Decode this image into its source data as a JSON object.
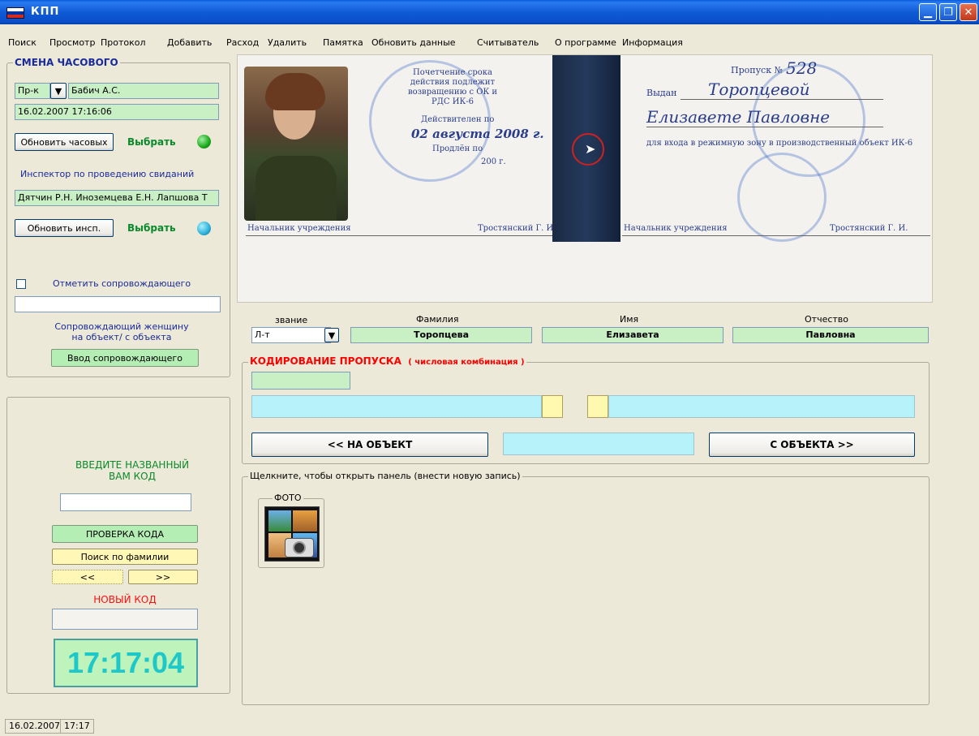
{
  "window": {
    "title": "КПП",
    "colors": {
      "titlebar": "#0a5bd8",
      "green_field": "#c8f0c4",
      "cyan_field": "#b7f2fa",
      "header_red": "#ff0000",
      "clock_text": "#1ec8c8"
    }
  },
  "menu": [
    "Поиск",
    "Просмотр",
    "Протокол",
    "Добавить",
    "Расход",
    "Удалить",
    "Памятка",
    "Обновить данные",
    "Считыватель",
    "О программе",
    "Информация"
  ],
  "guard": {
    "title": "СМЕНА ЧАСОВОГО",
    "rank": "Пр-к",
    "name": "Бабич А.С.",
    "datetime": "16.02.2007 17:16:06",
    "refresh_guards": "Обновить часовых",
    "select1": "Выбрать",
    "inspector_label": "Инспектор по проведению свиданий",
    "inspectors": "Дятчин Р.Н. Иноземцева Е.Н. Лапшова Т",
    "refresh_insp": "Обновить инсп.",
    "select2": "Выбрать",
    "escort_checkbox": "Отметить сопровождающего",
    "escort_value": "",
    "escort_note": "Сопровождающий женщину\nна объект/ с объекта",
    "escort_button": "Ввод сопровождающего"
  },
  "code_panel": {
    "prompt": "ВВЕДИТЕ НАЗВАННЫЙ ВАМ КОД",
    "input": "",
    "check_button": "ПРОВЕРКА КОДА",
    "search_button": "Поиск по фамилии",
    "prev": "<<",
    "next": ">>",
    "new_code_label": "НОВЫЙ КОД",
    "new_code_value": "",
    "clock": "17:17:04"
  },
  "document": {
    "pass_label": "Пропуск №",
    "pass_number": "528",
    "issued_label": "Выдан",
    "issued_to": "Торопцевой",
    "issued_name": "Елизавете Павловне",
    "left_stamp_text": "Почетчение срока действия подлежит возвращению с ОК и РДС ИК-6",
    "valid_label": "Действителен по",
    "valid_date": "02 августа 2008 г.",
    "extended": "Продлён по",
    "year": "200   г.",
    "purpose": "для входа в режимную зону в производственный объект ИК-6",
    "chief_left": "Начальник учреждения",
    "sign_left": "Тростянский Г. И.",
    "chief_right": "Начальник учреждения",
    "sign_right": "Тростянский Г. И."
  },
  "person": {
    "rank_label": "звание",
    "rank": "Л-т",
    "surname_label": "Фамилия",
    "surname": "Торопцева",
    "name_label": "Имя",
    "name": "Елизавета",
    "patronymic_label": "Отчество",
    "patronymic": "Павловна"
  },
  "coding": {
    "title": "КОДИРОВАНИЕ ПРОПУСКА",
    "subtitle": "( числовая комбинация )",
    "field1": "",
    "field2": "",
    "field3": "",
    "to_object": "<< НА ОБЪЕКТ",
    "middle": "",
    "from_object": "С ОБЪЕКТА >>"
  },
  "records": {
    "hint": "Щелкните, чтобы открыть панель (внести новую запись)",
    "photo_label": "ФОТО"
  },
  "status": {
    "date": "16.02.2007",
    "time": "17:17"
  }
}
